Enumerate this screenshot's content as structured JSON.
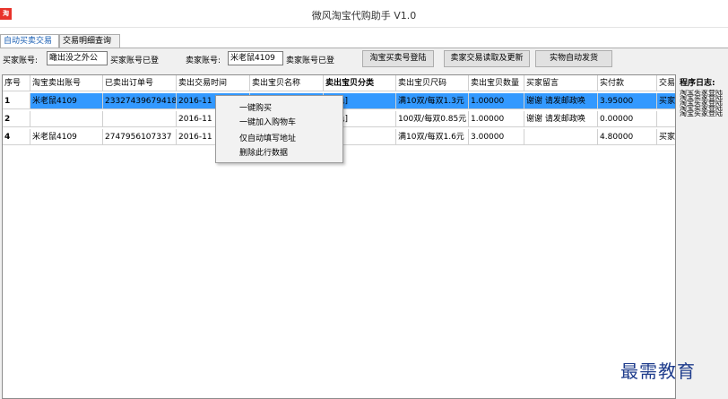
{
  "window": {
    "title": "微风淘宝代购助手 V1.0",
    "logo": "淘"
  },
  "tabs": [
    {
      "label": "自动买卖交易"
    },
    {
      "label": "交易明细查询"
    }
  ],
  "toolbar": {
    "buyer_label": "买家账号:",
    "buyer_value": "瞰出没之外公",
    "buyer_status": "买家账号已登",
    "seller_label": "卖家账号:",
    "seller_value": "米老鼠4109",
    "seller_status": "卖家账号已登",
    "btn_login": "淘宝买卖号登陆",
    "btn_read": "卖家交易读取及更新",
    "btn_ship": "实物自动发货"
  },
  "table": {
    "columns": [
      "序号",
      "淘宝卖出账号",
      "已卖出订单号",
      "卖出交易时间",
      "卖出宝贝名称",
      "卖出宝贝分类",
      "卖出宝贝尺码",
      "卖出宝贝数量",
      "买家留言",
      "实付款",
      "交易"
    ],
    "rows": [
      [
        "1",
        "米老鼠4109",
        "23327439679418",
        "2016-11",
        "",
        "[白色]",
        "满10双/每双1.3元",
        "1.00000",
        "谢谢 请发邮政唤",
        "3.95000",
        "买家"
      ],
      [
        "2",
        "",
        "",
        "2016-11",
        "",
        "[黑色]",
        "100双/每双0.85元",
        "1.00000",
        "谢谢 请发邮政唤",
        "0.00000",
        ""
      ],
      [
        "4",
        "米老鼠4109",
        "2747956107337",
        "2016-11",
        "",
        "列",
        "满10双/每双1.6元",
        "3.00000",
        "",
        "4.80000",
        "买家"
      ]
    ]
  },
  "log": {
    "title": "程序日志:",
    "lines": [
      "淘宝买家登陆",
      "淘宝卖家登陆",
      "淘宝买家登陆",
      "淘宝卖家登陆",
      "淘宝买家登陆"
    ]
  },
  "context_menu": {
    "items": [
      "一键购买",
      "一键加入购物车",
      "仅自动填写地址",
      "删除此行数据"
    ]
  },
  "watermark": "最需教育"
}
